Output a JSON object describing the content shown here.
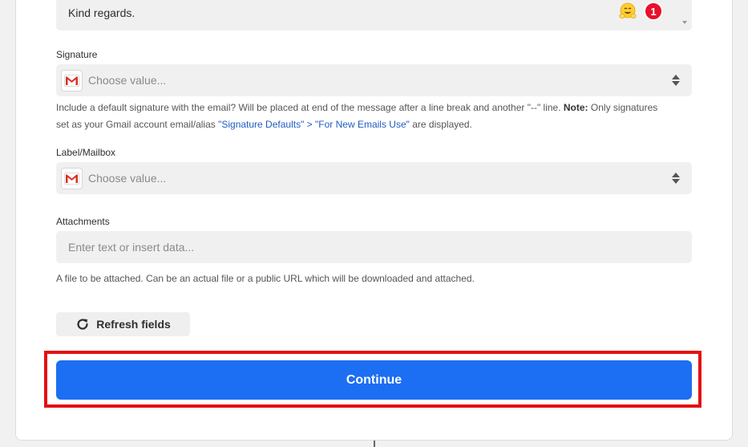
{
  "message": {
    "body_text": "Kind regards.",
    "badge_count": "1"
  },
  "signature": {
    "label": "Signature",
    "placeholder": "Choose value...",
    "help_part1": "Include a default signature with the email? Will be placed at end of the message after a line break and another \"--\" line. ",
    "help_note_label": "Note:",
    "help_part2": " Only signatures set as your Gmail account email/alias ",
    "help_link": "\"Signature Defaults\" > \"For New Emails Use\"",
    "help_part3": " are displayed."
  },
  "label_mailbox": {
    "label": "Label/Mailbox",
    "placeholder": "Choose value..."
  },
  "attachments": {
    "label": "Attachments",
    "placeholder": "Enter text or insert data...",
    "help": "A file to be attached. Can be an actual file or a public URL which will be downloaded and attached."
  },
  "actions": {
    "refresh_label": "Refresh fields",
    "continue_label": "Continue"
  },
  "colors": {
    "primary": "#1c6ef2",
    "highlight": "#e40f12",
    "badge": "#e8102b",
    "link": "#1f5cc4"
  },
  "icons": {
    "emoji": "hugging-face-icon",
    "gmail": "gmail-icon",
    "sort": "sort-arrows-icon",
    "refresh": "refresh-icon"
  }
}
